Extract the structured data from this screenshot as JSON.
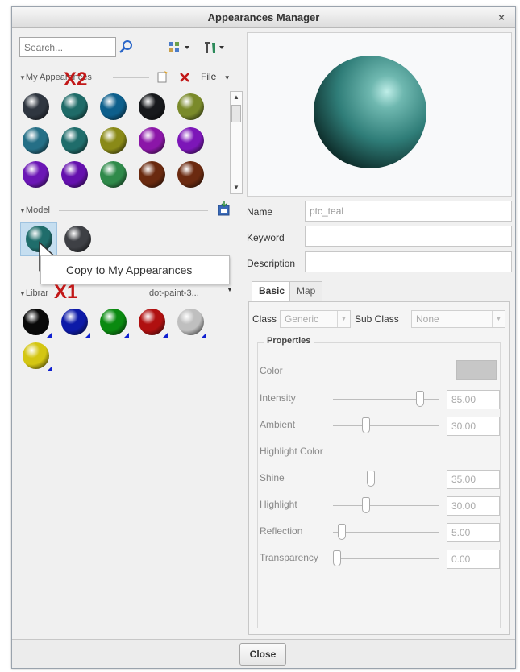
{
  "dialog": {
    "title": "Appearances Manager",
    "close_glyph": "×"
  },
  "search": {
    "placeholder": "Search..."
  },
  "my_appearances": {
    "header": "My Appearances",
    "file_label": "File",
    "swatches": [
      "#2f3640",
      "#1f6b68",
      "#0d5f8c",
      "#17191c",
      "#7a8a2a",
      "#256f86",
      "#1f6d6b",
      "#8a8a17",
      "#8b16a8",
      "#7c16b8",
      "#6b16b5",
      "#6410ad",
      "#2f8a4a",
      "#6a2a0f",
      "#6b2a10"
    ]
  },
  "model": {
    "header": "Model",
    "swatches": [
      "#1f6d6b",
      "#3e4045"
    ]
  },
  "library": {
    "header_label": "Librar",
    "dropdown_text": "dot-paint-3...",
    "swatches": [
      "#0a0a0a",
      "#0d1aa8",
      "#0a8a10",
      "#b01010",
      "#bfbfbf",
      "#d4c612"
    ]
  },
  "tooltip": {
    "text": "Copy to My Appearances"
  },
  "annotations": {
    "x1": "X1",
    "x2": "X2"
  },
  "properties_panel": {
    "name_label": "Name",
    "name_value": "ptc_teal",
    "keyword_label": "Keyword",
    "keyword_value": "",
    "description_label": "Description",
    "description_value": ""
  },
  "tabs": {
    "basic": "Basic",
    "map": "Map"
  },
  "class_row": {
    "class_label": "Class",
    "class_value": "Generic",
    "subclass_label": "Sub Class",
    "subclass_value": "None"
  },
  "properties": {
    "title": "Properties",
    "color_label": "Color",
    "highlight_color_label": "Highlight Color",
    "sliders": [
      {
        "label": "Intensity",
        "value": "85.00",
        "fraction": 0.85
      },
      {
        "label": "Ambient",
        "value": "30.00",
        "fraction": 0.3
      },
      {
        "label": "Shine",
        "value": "35.00",
        "fraction": 0.35
      },
      {
        "label": "Highlight",
        "value": "30.00",
        "fraction": 0.3
      },
      {
        "label": "Reflection",
        "value": "5.00",
        "fraction": 0.05
      },
      {
        "label": "Transparency",
        "value": "0.00",
        "fraction": 0.0
      }
    ]
  },
  "footer": {
    "close_label": "Close"
  },
  "colors": {
    "preview_sphere": "#3f8e8a",
    "accent_red": "#c21818"
  }
}
